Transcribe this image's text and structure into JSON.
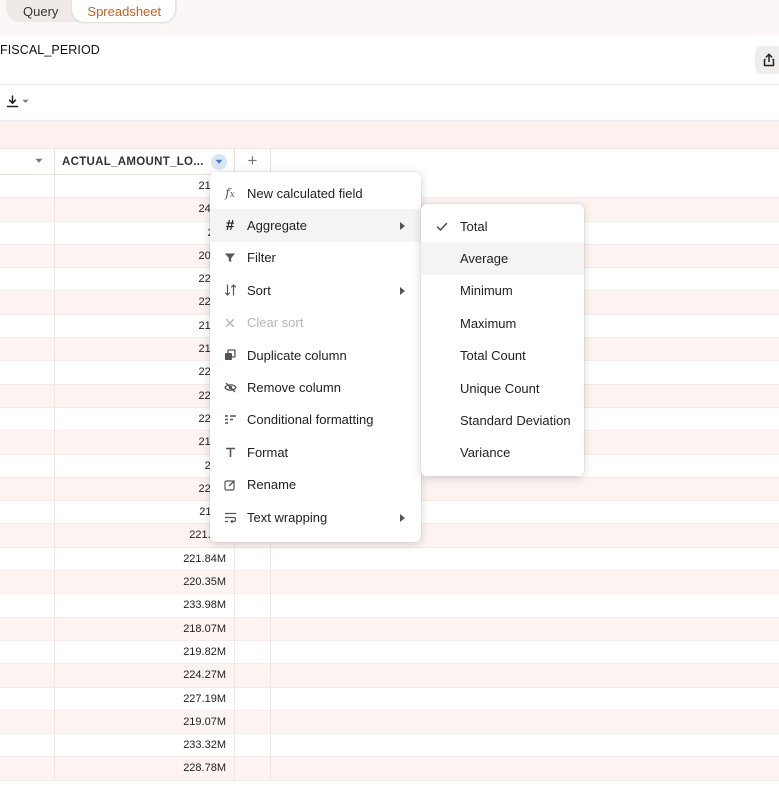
{
  "tabs": [
    "Query",
    "Spreadsheet"
  ],
  "page_title": "FISCAL_PERIOD",
  "icons": {
    "share": "share-icon",
    "download": "download-icon",
    "column_menu": "chevron-down-icon",
    "add_column": "plus-icon"
  },
  "grid": {
    "column_header": "ACTUAL_AMOUNT_LO...",
    "add_column_label": "+",
    "visible_values": [
      "217.4",
      "243.4",
      "227",
      "208.6",
      "229.8",
      "222.6",
      "219.2",
      "219.2",
      "226.3",
      "224.3",
      "228.9",
      "217.6",
      "226.",
      "222.7",
      "211.0",
      "221.0...",
      "221.84M",
      "220.35M",
      "233.98M",
      "218.07M",
      "219.82M",
      "224.27M",
      "227.19M",
      "219.07M",
      "233.32M",
      "228.78M"
    ]
  },
  "context_menu": {
    "items": [
      {
        "label": "New calculated field",
        "icon": "function-icon",
        "submenu": false,
        "disabled": false
      },
      {
        "label": "Aggregate",
        "icon": "hash-icon",
        "submenu": true,
        "disabled": false
      },
      {
        "label": "Filter",
        "icon": "filter-icon",
        "submenu": false,
        "disabled": false
      },
      {
        "label": "Sort",
        "icon": "sort-icon",
        "submenu": true,
        "disabled": false
      },
      {
        "label": "Clear sort",
        "icon": "close-icon",
        "submenu": false,
        "disabled": true
      },
      {
        "label": "Duplicate column",
        "icon": "duplicate-icon",
        "submenu": false,
        "disabled": false
      },
      {
        "label": "Remove column",
        "icon": "eye-off-icon",
        "submenu": false,
        "disabled": false
      },
      {
        "label": "Conditional formatting",
        "icon": "conditional-format-icon",
        "submenu": false,
        "disabled": false
      },
      {
        "label": "Format",
        "icon": "text-format-icon",
        "submenu": false,
        "disabled": false
      },
      {
        "label": "Rename",
        "icon": "edit-icon",
        "submenu": false,
        "disabled": false
      },
      {
        "label": "Text wrapping",
        "icon": "text-wrap-icon",
        "submenu": true,
        "disabled": false
      }
    ]
  },
  "aggregate_submenu": {
    "items": [
      {
        "label": "Total",
        "checked": true
      },
      {
        "label": "Average",
        "checked": false
      },
      {
        "label": "Minimum",
        "checked": false
      },
      {
        "label": "Maximum",
        "checked": false
      },
      {
        "label": "Total Count",
        "checked": false
      },
      {
        "label": "Unique Count",
        "checked": false
      },
      {
        "label": "Standard Deviation",
        "checked": false
      },
      {
        "label": "Variance",
        "checked": false
      }
    ]
  },
  "colors": {
    "accent": "#c8611a",
    "row_alt": "#fdf4f2",
    "band": "#fcf1ee"
  }
}
